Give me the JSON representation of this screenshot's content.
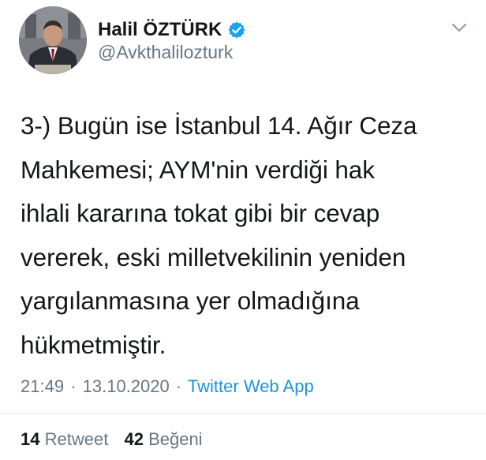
{
  "user": {
    "display_name": "Halil ÖZTÜRK",
    "handle": "@Avkthalilozturk",
    "verified_icon": "verified-badge-icon"
  },
  "tweet": {
    "lines": [
      "3-) Bugün ise İstanbul 14. Ağır Ceza",
      "Mahkemesi; AYM'nin verdiği hak",
      "ihlali kararına tokat gibi bir cevap",
      "vererek, eski milletvekilinin yeniden",
      "yargılanmasına yer olmadığına",
      "hükmetmiştir."
    ]
  },
  "meta": {
    "time": "21:49",
    "separator": "·",
    "date": "13.10.2020",
    "source": "Twitter Web App"
  },
  "stats": {
    "retweet_count": "14",
    "retweet_label": "Retweet",
    "like_count": "42",
    "like_label": "Beğeni"
  },
  "colors": {
    "text": "#14171a",
    "muted": "#657786",
    "link": "#1b95e0",
    "verified": "#1da1f2",
    "divider": "#e1e8ed"
  }
}
